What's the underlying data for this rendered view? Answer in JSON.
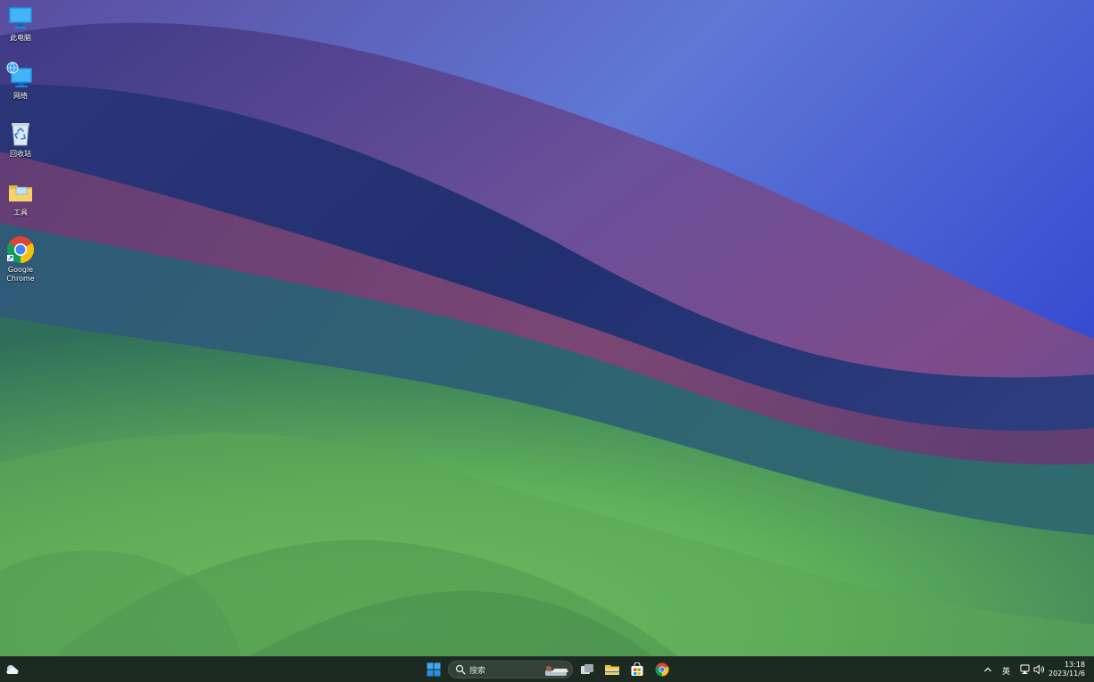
{
  "desktop": {
    "icons": [
      {
        "label": "此电脑",
        "icon": "computer-icon"
      },
      {
        "label": "网络",
        "icon": "network-icon"
      },
      {
        "label": "回收站",
        "icon": "recycle-bin-icon"
      },
      {
        "label": "工具",
        "icon": "folder-icon"
      },
      {
        "label": "Google Chrome",
        "icon": "chrome-icon"
      }
    ]
  },
  "taskbar": {
    "weather_icon": "weather-icon",
    "start_icon": "windows-start-icon",
    "search": {
      "label": "搜索",
      "icon": "search-icon"
    },
    "pinned": [
      {
        "icon": "task-view-icon"
      },
      {
        "icon": "file-explorer-icon"
      },
      {
        "icon": "microsoft-store-icon"
      },
      {
        "icon": "chrome-icon"
      }
    ],
    "tray": {
      "overflow_icon": "chevron-up-icon",
      "ime": "英",
      "network_icon": "network-status-icon",
      "volume_icon": "volume-icon",
      "time": "13:18",
      "date": "2023/11/6"
    }
  },
  "colors": {
    "taskbar_bg": "#1d2a22",
    "accent": "#0078d4"
  }
}
